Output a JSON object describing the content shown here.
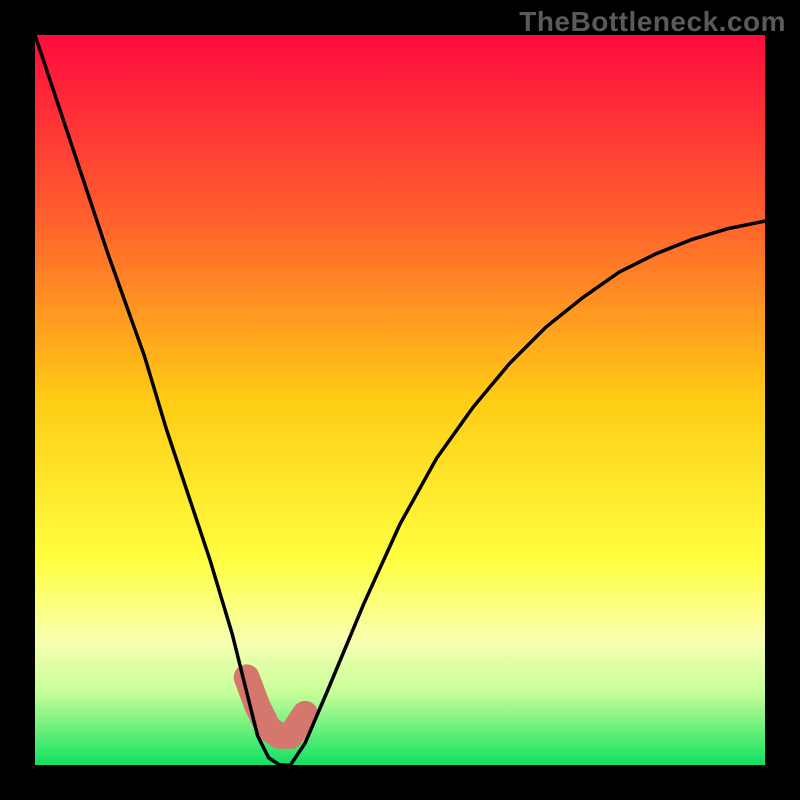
{
  "watermark": "TheBottleneck.com",
  "chart_data": {
    "type": "line",
    "title": "",
    "xlabel": "",
    "ylabel": "",
    "xlim": [
      0,
      100
    ],
    "ylim": [
      0,
      100
    ],
    "series": [
      {
        "name": "bottleneck-curve",
        "x": [
          0,
          5,
          10,
          15,
          18,
          21,
          24,
          27,
          29,
          30.5,
          32,
          33.5,
          35,
          37,
          40,
          45,
          50,
          55,
          60,
          65,
          70,
          75,
          80,
          85,
          90,
          95,
          100
        ],
        "values": [
          100,
          85,
          70,
          56,
          46,
          37,
          28,
          18,
          10,
          4,
          1,
          0,
          0,
          3,
          10,
          22,
          33,
          42,
          49,
          55,
          60,
          64,
          67.5,
          70,
          72,
          73.5,
          74.5
        ]
      }
    ],
    "highlight_range_x": [
      29,
      37
    ],
    "gradient_stops": [
      {
        "offset": 0,
        "color": "#ff0b3f"
      },
      {
        "offset": 25,
        "color": "#ff5f2d"
      },
      {
        "offset": 50,
        "color": "#ffcc15"
      },
      {
        "offset": 72,
        "color": "#ffff40"
      },
      {
        "offset": 83,
        "color": "#f7ffb0"
      },
      {
        "offset": 90,
        "color": "#c8ff9a"
      },
      {
        "offset": 100,
        "color": "#10e060"
      }
    ],
    "highlight_color": "#d5776d",
    "curve_color": "#000000"
  }
}
